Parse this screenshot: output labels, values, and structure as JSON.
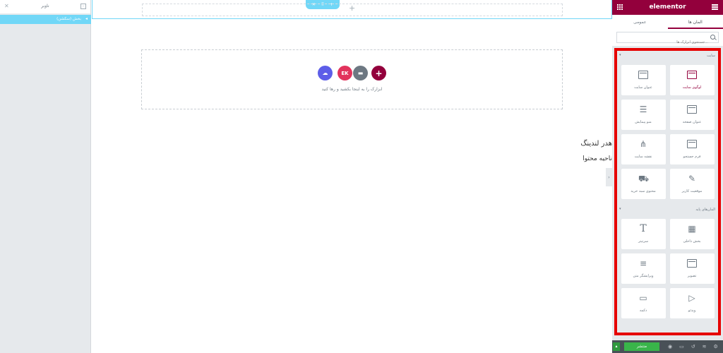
{
  "navigator": {
    "title": "ناوبر",
    "row_label": "بخش (سکشن)"
  },
  "canvas": {
    "empty_hint": "ابزارک را به اینجا بکشید و رها کنید",
    "landing_title": "هدر لندینگ",
    "content_area": "ناحیه محتوا"
  },
  "panel": {
    "logo": "elementor",
    "tabs": [
      "المان ها",
      "عمومی"
    ],
    "search_placeholder": "جستجوی ابزارک ها..."
  },
  "categories": [
    {
      "title": "سایت",
      "widgets": [
        {
          "label": "لوگوی سایت",
          "icon": "site-logo-icon",
          "active": true
        },
        {
          "label": "عنوان سایت",
          "icon": "site-title-icon",
          "active": false
        },
        {
          "label": "عنوان صفحه",
          "icon": "page-title-icon",
          "active": false
        },
        {
          "label": "منو پیمایش",
          "icon": "nav-menu-icon",
          "active": false
        },
        {
          "label": "فرم جستجو",
          "icon": "search-form-icon",
          "active": false
        },
        {
          "label": "نقشه سایت",
          "icon": "sitemap-icon",
          "active": false
        },
        {
          "label": "موقعیت کاربر",
          "icon": "user-location-icon",
          "active": false
        },
        {
          "label": "محتوی سبد خرید",
          "icon": "cart-icon",
          "active": false
        }
      ]
    },
    {
      "title": "المان‌های پایه",
      "widgets": [
        {
          "label": "بخش داخلی",
          "icon": "inner-section-icon",
          "active": false
        },
        {
          "label": "سرتیتر",
          "icon": "heading-icon",
          "active": false
        },
        {
          "label": "تصویر",
          "icon": "image-icon",
          "active": false
        },
        {
          "label": "ویرایشگر متن",
          "icon": "text-editor-icon",
          "active": false
        },
        {
          "label": "ویدئو",
          "icon": "video-icon",
          "active": false
        },
        {
          "label": "دکمه",
          "icon": "button-icon",
          "active": false
        }
      ]
    }
  ],
  "footer": {
    "publish_label": "منتشر"
  },
  "colors": {
    "accent": "#93003c",
    "highlight_frame": "#e60000",
    "selection": "#71d7f7",
    "publish": "#39b54a"
  }
}
